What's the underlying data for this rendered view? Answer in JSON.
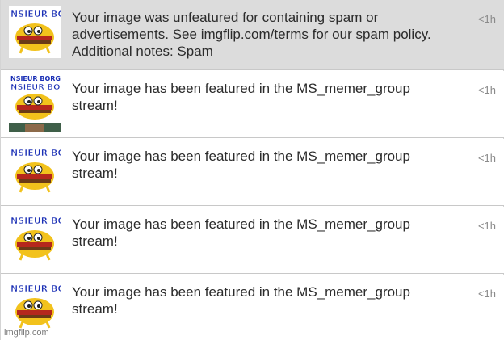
{
  "notifications": [
    {
      "message": "Your image was unfeatured for containing spam or advertisements. See imgflip.com/terms for our spam policy. Additional notes: Spam",
      "time": "<1h",
      "thumbnail_icon": "burger-meme-thumbnail-icon",
      "unread": true
    },
    {
      "message": "Your image has been featured in the MS_memer_group stream!",
      "time": "<1h",
      "thumbnail_icon": "burger-meme-thumbnail-icon",
      "unread": false
    },
    {
      "message": "Your image has been featured in the MS_memer_group stream!",
      "time": "<1h",
      "thumbnail_icon": "burger-meme-thumbnail-icon",
      "unread": false
    },
    {
      "message": "Your image has been featured in the MS_memer_group stream!",
      "time": "<1h",
      "thumbnail_icon": "burger-meme-thumbnail-icon",
      "unread": false
    },
    {
      "message": "Your image has been featured in the MS_memer_group stream!",
      "time": "<1h",
      "thumbnail_icon": "burger-meme-thumbnail-icon",
      "unread": false
    }
  ],
  "watermark": "imgflip.com",
  "colors": {
    "unread_background": "#dcdcdc",
    "message_text": "#2b2b2b",
    "time_text": "#8a8a8a"
  }
}
